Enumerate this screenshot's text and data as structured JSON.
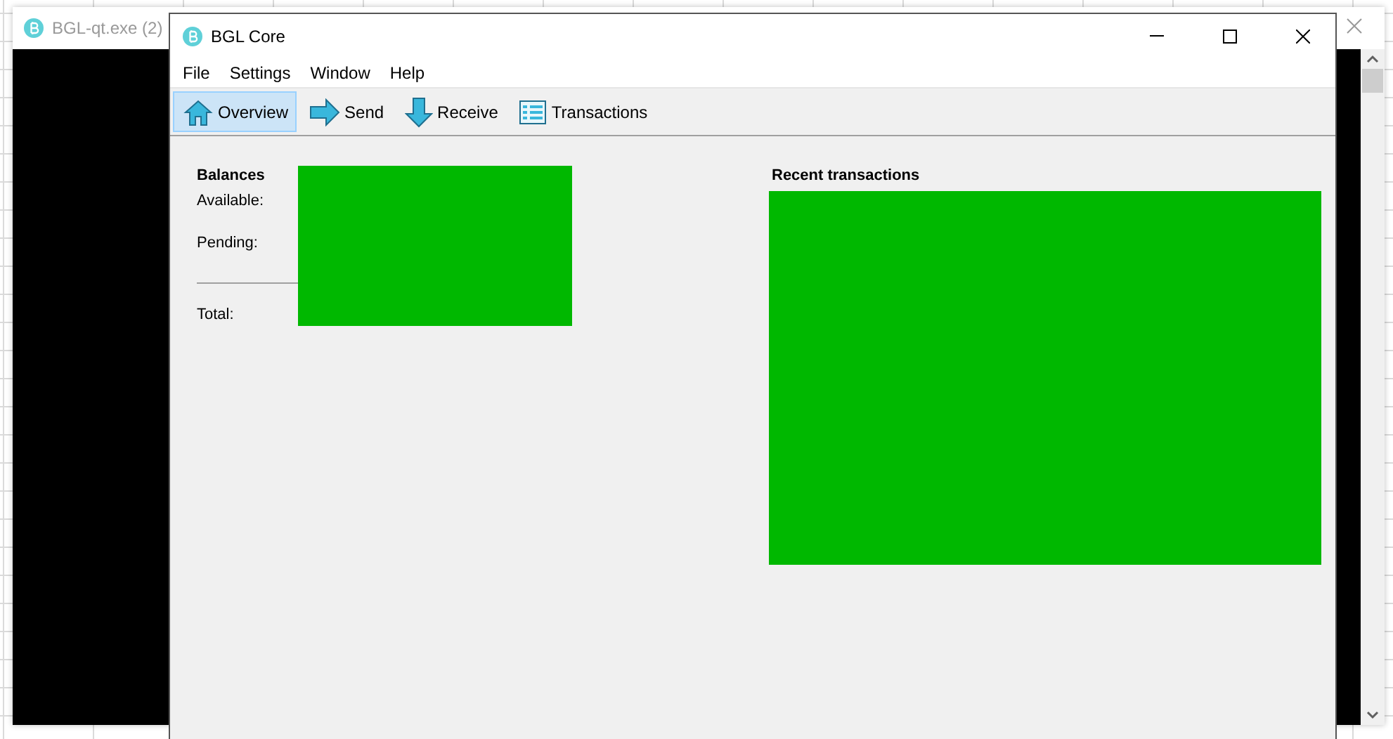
{
  "back_window": {
    "title": "BGL-qt.exe (2)"
  },
  "window": {
    "title": "BGL Core"
  },
  "menu": [
    "File",
    "Settings",
    "Window",
    "Help"
  ],
  "toolbar": [
    {
      "label": "Overview",
      "kind": "home",
      "selected": true
    },
    {
      "label": "Send",
      "kind": "send",
      "selected": false
    },
    {
      "label": "Receive",
      "kind": "receive",
      "selected": false
    },
    {
      "label": "Transactions",
      "kind": "list",
      "selected": false
    }
  ],
  "balances": {
    "title": "Balances",
    "labels": [
      "Available:",
      "Pending:",
      "Total:"
    ]
  },
  "recent_transactions": {
    "title": "Recent transactions"
  }
}
